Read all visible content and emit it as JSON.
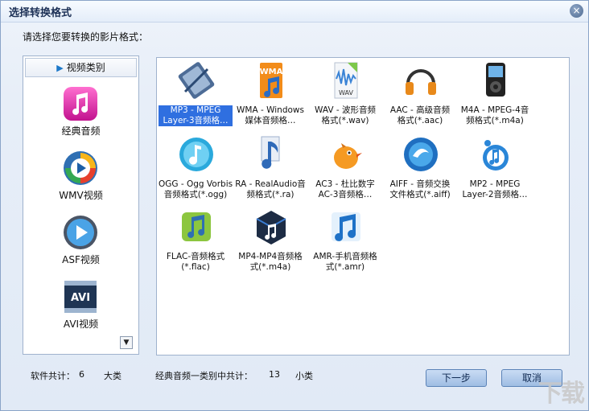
{
  "window": {
    "title": "选择转换格式",
    "close_glyph": "×",
    "prompt": "请选择您要转换的影片格式："
  },
  "categories": {
    "header_label": "视频类别",
    "items": [
      {
        "label": "经典音频",
        "icon": "music-note-icon"
      },
      {
        "label": "WMV视频",
        "icon": "windows-media-icon"
      },
      {
        "label": "ASF视频",
        "icon": "play-icon"
      },
      {
        "label": "AVI视频",
        "icon": "avi-film-icon"
      }
    ],
    "scroll_glyph": "▼"
  },
  "formats": [
    {
      "line1": "MP3 - MPEG",
      "line2": "Layer-3音频格…",
      "icon": "mp3-icon",
      "selected": true
    },
    {
      "line1": "WMA - Windows",
      "line2": "媒体音频格…",
      "icon": "wma-icon",
      "selected": false
    },
    {
      "line1": "WAV - 波形音频",
      "line2": "格式(*.wav)",
      "icon": "wav-icon",
      "selected": false
    },
    {
      "line1": "AAC - 高级音频",
      "line2": "格式(*.aac)",
      "icon": "headphones-icon",
      "selected": false
    },
    {
      "line1": "M4A - MPEG-4音",
      "line2": "频格式(*.m4a)",
      "icon": "ipod-icon",
      "selected": false
    },
    {
      "line1": "OGG - Ogg Vorbis",
      "line2": "音频格式(*.ogg)",
      "icon": "ogg-icon",
      "selected": false
    },
    {
      "line1": "RA - RealAudio音",
      "line2": "频格式(*.ra)",
      "icon": "ra-icon",
      "selected": false
    },
    {
      "line1": "AC3 - 杜比数字",
      "line2": "AC-3音频格…",
      "icon": "bird-icon",
      "selected": false
    },
    {
      "line1": "AIFF - 音频交换",
      "line2": "文件格式(*.aiff)",
      "icon": "aiff-icon",
      "selected": false
    },
    {
      "line1": "MP2 - MPEG",
      "line2": "Layer-2音频格…",
      "icon": "mp2-icon",
      "selected": false
    },
    {
      "line1": "FLAC-音频格式",
      "line2": "(*.flac)",
      "icon": "flac-icon",
      "selected": false
    },
    {
      "line1": "MP4-MP4音频格",
      "line2": "式(*.m4a)",
      "icon": "mp4-icon",
      "selected": false
    },
    {
      "line1": "AMR-手机音频格",
      "line2": "式(*.amr)",
      "icon": "amr-icon",
      "selected": false
    }
  ],
  "status": {
    "software_total_label": "软件共计：",
    "software_total": "6",
    "category_unit": "大类",
    "subcategory_label": "经典音频一类别中共计：",
    "subcategory_total": "13",
    "subcategory_unit": "小类"
  },
  "buttons": {
    "next": "下一步",
    "cancel": "取消"
  },
  "watermark": "下载"
}
